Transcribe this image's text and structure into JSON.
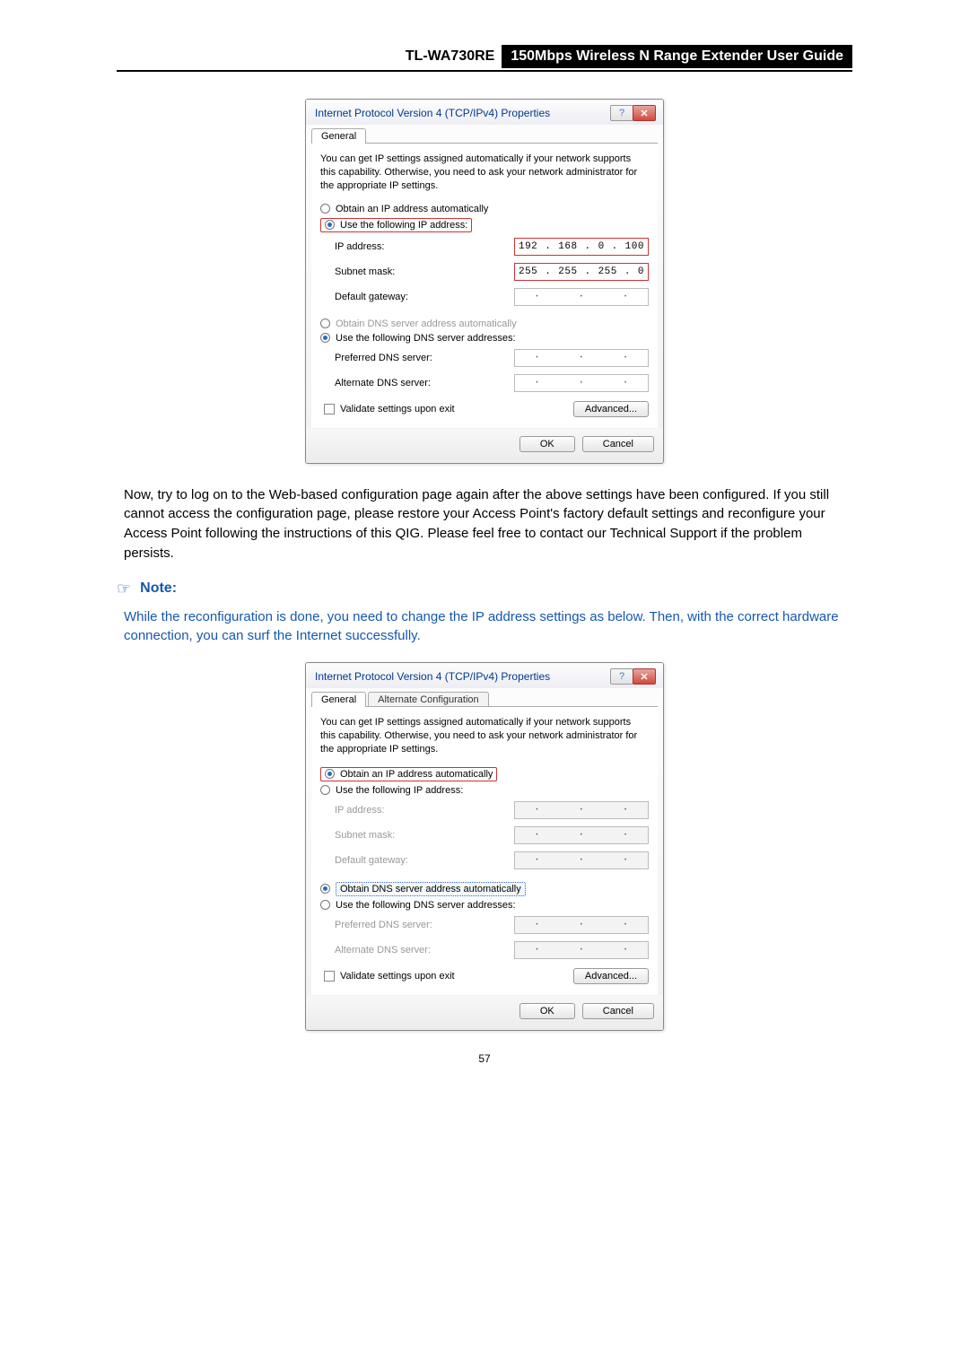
{
  "header": {
    "model": "TL-WA730RE",
    "guide": "150Mbps Wireless N Range Extender User Guide"
  },
  "dialog1": {
    "title": "Internet Protocol Version 4 (TCP/IPv4) Properties",
    "help_btn": "?",
    "close_btn": "✕",
    "tab_general": "General",
    "desc": "You can get IP settings assigned automatically if your network supports this capability. Otherwise, you need to ask your network administrator for the appropriate IP settings.",
    "opt_ip_auto": "Obtain an IP address automatically",
    "opt_ip_manual": "Use the following IP address:",
    "lbl_ip": "IP address:",
    "lbl_subnet": "Subnet mask:",
    "lbl_gateway": "Default gateway:",
    "ip": [
      "192",
      "168",
      "0",
      "100"
    ],
    "subnet": [
      "255",
      "255",
      "255",
      "0"
    ],
    "opt_dns_auto": "Obtain DNS server address automatically",
    "opt_dns_manual": "Use the following DNS server addresses:",
    "lbl_pref_dns": "Preferred DNS server:",
    "lbl_alt_dns": "Alternate DNS server:",
    "validate": "Validate settings upon exit",
    "advanced": "Advanced...",
    "ok": "OK",
    "cancel": "Cancel"
  },
  "para1": "Now, try to log on to the Web-based configuration page again after the above settings have been configured. If you still cannot access the configuration page, please restore your Access Point's factory default settings and reconfigure your Access Point following the instructions of this QIG. Please feel free to contact our Technical Support if the problem persists.",
  "note_label": "Note:",
  "note_text": "While the reconfiguration is done, you need to change the IP address settings as below. Then, with the correct hardware connection, you can surf the Internet successfully.",
  "dialog2": {
    "title": "Internet Protocol Version 4 (TCP/IPv4) Properties",
    "help_btn": "?",
    "close_btn": "✕",
    "tab_general": "General",
    "tab_alt": "Alternate Configuration",
    "desc": "You can get IP settings assigned automatically if your network supports this capability. Otherwise, you need to ask your network administrator for the appropriate IP settings.",
    "opt_ip_auto": "Obtain an IP address automatically",
    "opt_ip_manual": "Use the following IP address:",
    "lbl_ip": "IP address:",
    "lbl_subnet": "Subnet mask:",
    "lbl_gateway": "Default gateway:",
    "opt_dns_auto": "Obtain DNS server address automatically",
    "opt_dns_manual": "Use the following DNS server addresses:",
    "lbl_pref_dns": "Preferred DNS server:",
    "lbl_alt_dns": "Alternate DNS server:",
    "validate": "Validate settings upon exit",
    "advanced": "Advanced...",
    "ok": "OK",
    "cancel": "Cancel"
  },
  "page_num": "57"
}
